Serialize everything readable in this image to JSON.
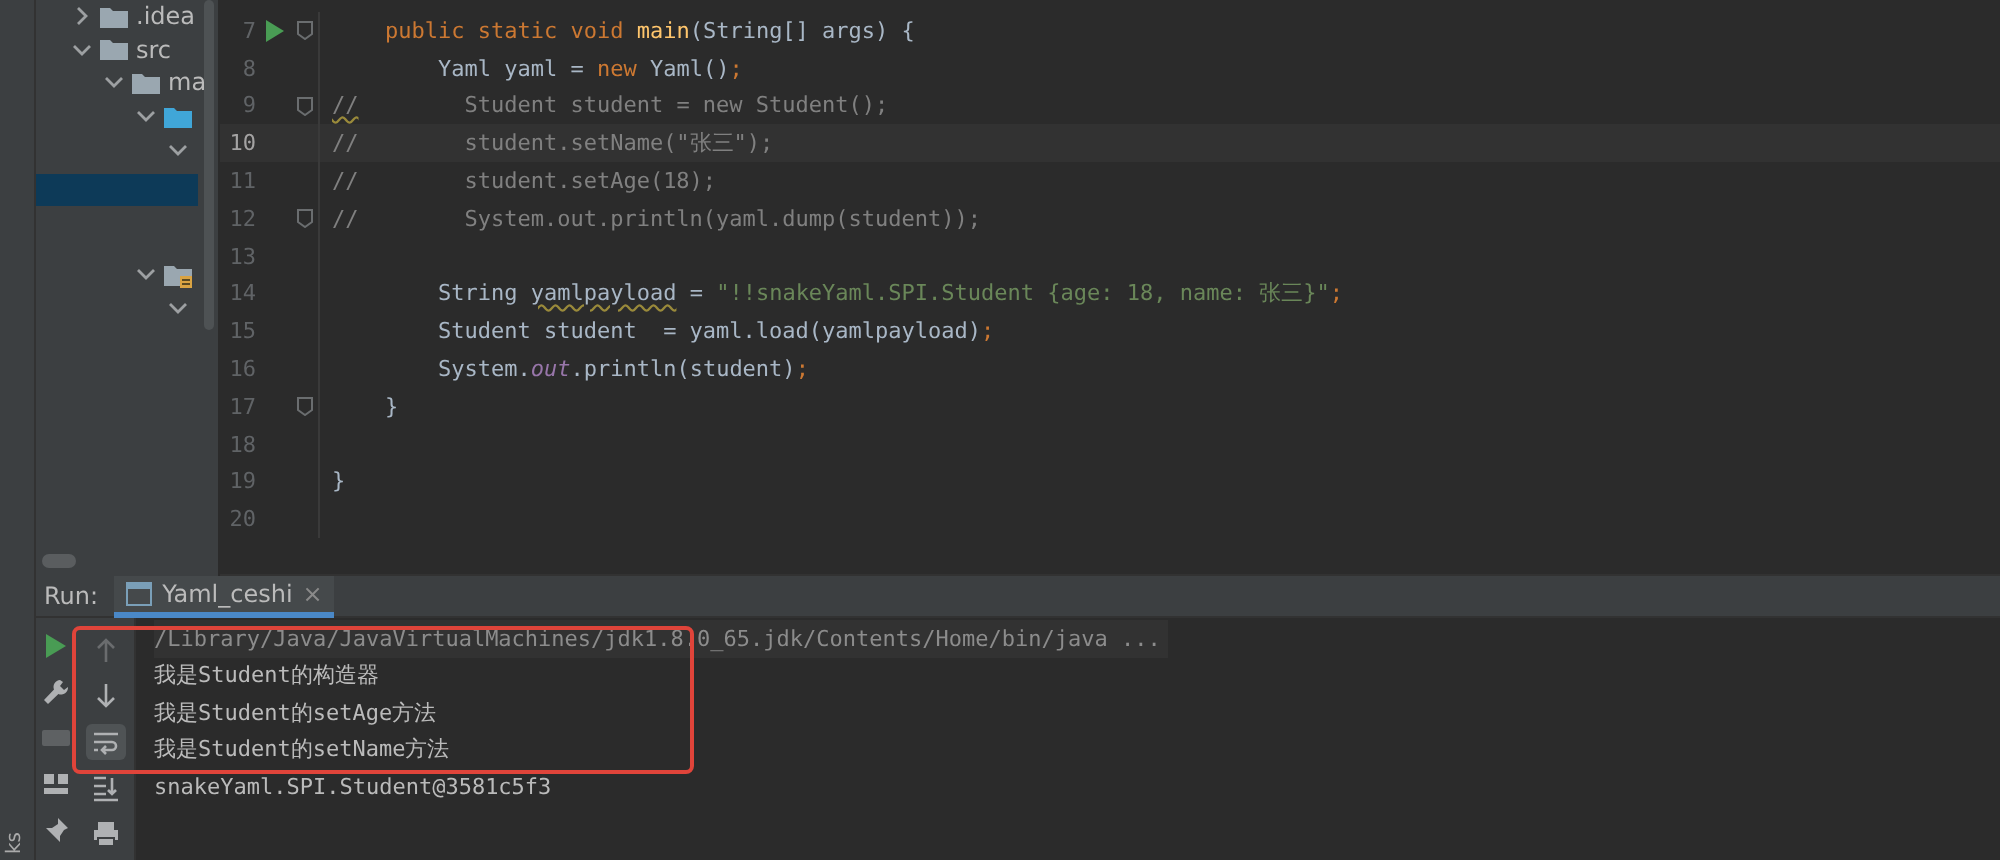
{
  "project_tree": {
    "items": [
      {
        "label": ".idea",
        "kind": "folder",
        "expanded": false
      },
      {
        "label": "src",
        "kind": "folder",
        "expanded": true,
        "children": [
          {
            "label": "ma",
            "kind": "folder",
            "expanded": true,
            "children": [
              {
                "kind": "source-folder",
                "expanded": true,
                "children": [
                  {
                    "expanded": true
                  }
                ]
              }
            ]
          }
        ]
      }
    ],
    "selected_row": {
      "selected": true
    },
    "lower_items": [
      {
        "kind": "resource-folder",
        "expanded": true,
        "children": [
          {
            "expanded": true
          }
        ]
      }
    ]
  },
  "editor": {
    "lines": [
      {
        "number": "7",
        "run": true,
        "fold": true,
        "current": false,
        "tokens": [
          {
            "kind": "keyword",
            "text": "    public static void "
          },
          {
            "kind": "method",
            "text": "main"
          },
          {
            "kind": "plain",
            "text": "(String[] args) {"
          }
        ]
      },
      {
        "number": "8",
        "run": false,
        "fold": false,
        "current": false,
        "tokens": [
          {
            "kind": "plain",
            "text": "        Yaml yaml = "
          },
          {
            "kind": "keyword",
            "text": "new"
          },
          {
            "kind": "plain",
            "text": " Yaml()"
          },
          {
            "kind": "keyword",
            "text": ";"
          }
        ]
      },
      {
        "number": "9",
        "run": false,
        "fold": true,
        "current": false,
        "tokens": [
          {
            "kind": "warn-comment",
            "text": "//"
          },
          {
            "kind": "comment",
            "text": "        Student student = new Student();"
          }
        ]
      },
      {
        "number": "10",
        "run": false,
        "fold": false,
        "current": true,
        "tokens": [
          {
            "kind": "comment",
            "text": "//        student.setName(\"张三\");"
          }
        ]
      },
      {
        "number": "11",
        "run": false,
        "fold": false,
        "current": false,
        "tokens": [
          {
            "kind": "comment",
            "text": "//        student.setAge(18);"
          }
        ]
      },
      {
        "number": "12",
        "run": false,
        "fold": true,
        "current": false,
        "tokens": [
          {
            "kind": "comment",
            "text": "//        System.out.println(yaml.dump(student));"
          }
        ]
      },
      {
        "number": "13",
        "run": false,
        "fold": false,
        "current": false
      },
      {
        "number": "14",
        "run": false,
        "fold": false,
        "current": false,
        "tokens": [
          {
            "kind": "plain",
            "text": "        String "
          },
          {
            "kind": "warn",
            "text": "yamlpayload"
          },
          {
            "kind": "plain",
            "text": " = "
          },
          {
            "kind": "string",
            "text": "\"!!snakeYaml.SPI.Student {age: 18, name: 张三}\""
          },
          {
            "kind": "keyword",
            "text": ";"
          }
        ]
      },
      {
        "number": "15",
        "run": false,
        "fold": false,
        "current": false,
        "tokens": [
          {
            "kind": "plain",
            "text": "        Student student  = yaml.load(yamlpayload)"
          },
          {
            "kind": "keyword",
            "text": ";"
          }
        ]
      },
      {
        "number": "16",
        "run": false,
        "fold": false,
        "current": false,
        "tokens": [
          {
            "kind": "plain",
            "text": "        System."
          },
          {
            "kind": "field",
            "text": "out"
          },
          {
            "kind": "plain",
            "text": ".println(student)"
          },
          {
            "kind": "keyword",
            "text": ";"
          }
        ]
      },
      {
        "number": "17",
        "run": false,
        "fold": true,
        "current": false,
        "tokens": [
          {
            "kind": "plain",
            "text": "    }"
          }
        ]
      },
      {
        "number": "18",
        "run": false,
        "fold": false,
        "current": false
      },
      {
        "number": "19",
        "run": false,
        "fold": false,
        "current": false,
        "tokens": [
          {
            "kind": "plain",
            "text": "}"
          }
        ]
      },
      {
        "number": "20",
        "run": false,
        "fold": false,
        "current": false
      }
    ]
  },
  "run_panel": {
    "label": "Run:",
    "tabs": [
      {
        "label": "Yaml_ceshi",
        "selected": true,
        "close": "×"
      }
    ],
    "side_label": "ks",
    "toolbar_1": [
      {
        "kind": "run"
      },
      {
        "kind": "wrench"
      },
      {
        "kind": "bar"
      },
      {
        "kind": "layout"
      },
      {
        "kind": "pin"
      }
    ],
    "toolbar_2": [
      {
        "kind": "up",
        "disabled": true,
        "selected": false
      },
      {
        "kind": "down",
        "disabled": false,
        "selected": false
      },
      {
        "kind": "wrap",
        "disabled": false,
        "selected": true
      },
      {
        "kind": "scroll-end",
        "disabled": false,
        "selected": false
      },
      {
        "kind": "print",
        "disabled": false,
        "selected": false
      }
    ],
    "console": [
      {
        "kind": "command",
        "text": "/Library/Java/JavaVirtualMachines/jdk1.8.0_65.jdk/Contents/Home/bin/java ..."
      },
      {
        "kind": "output",
        "text": "我是Student的构造器"
      },
      {
        "kind": "output",
        "text": "我是Student的setAge方法"
      },
      {
        "kind": "output",
        "text": "我是Student的setName方法"
      },
      {
        "kind": "output",
        "text": "snakeYaml.SPI.Student@3581c5f3"
      }
    ],
    "highlight": {
      "kind": "box"
    }
  }
}
